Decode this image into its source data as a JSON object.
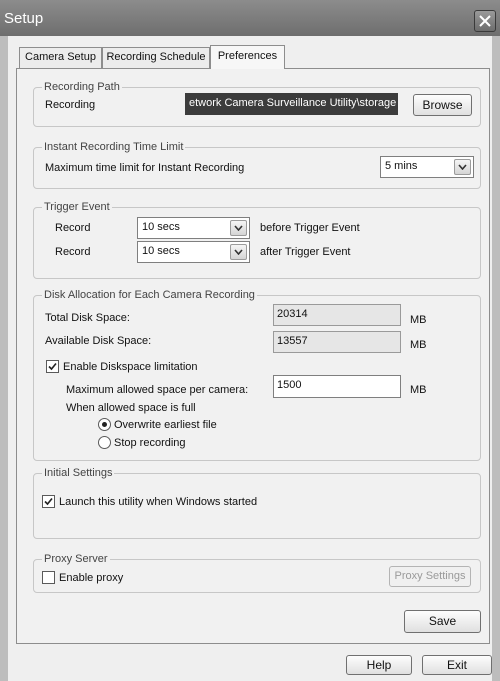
{
  "window": {
    "title": "Setup"
  },
  "tabs": [
    {
      "label": "Camera Setup"
    },
    {
      "label": "Recording Schedule"
    },
    {
      "label": "Preferences"
    }
  ],
  "active_tab": "Preferences",
  "recording_path": {
    "group_title": "Recording Path",
    "label": "Recording",
    "value": "etwork Camera Surveillance Utility\\storage",
    "browse_label": "Browse"
  },
  "instant_recording": {
    "group_title": "Instant Recording Time Limit",
    "label": "Maximum time limit for Instant Recording",
    "value": "5 mins"
  },
  "trigger_event": {
    "group_title": "Trigger Event",
    "before": {
      "label": "Record",
      "value": "10 secs",
      "suffix": "before Trigger Event"
    },
    "after": {
      "label": "Record",
      "value": "10 secs",
      "suffix": "after Trigger Event"
    }
  },
  "disk_allocation": {
    "group_title": "Disk Allocation for Each Camera Recording",
    "total": {
      "label": "Total Disk Space:",
      "value": "20314",
      "unit": "MB"
    },
    "available": {
      "label": "Available Disk Space:",
      "value": "13557",
      "unit": "MB"
    },
    "enable_limit": {
      "label": "Enable Diskspace limitation",
      "checked": true
    },
    "max_per_camera": {
      "label": "Maximum allowed space per camera:",
      "value": "1500",
      "unit": "MB"
    },
    "when_full_label": "When allowed space is full",
    "options": [
      {
        "label": "Overwrite earliest file",
        "selected": true
      },
      {
        "label": "Stop recording",
        "selected": false
      }
    ]
  },
  "initial_settings": {
    "group_title": "Initial Settings",
    "launch": {
      "label": "Launch this utility when Windows started",
      "checked": true
    }
  },
  "proxy": {
    "group_title": "Proxy Server",
    "enable": {
      "label": "Enable proxy",
      "checked": false
    },
    "settings_label": "Proxy Settings"
  },
  "buttons": {
    "save": "Save",
    "help": "Help",
    "exit": "Exit"
  }
}
